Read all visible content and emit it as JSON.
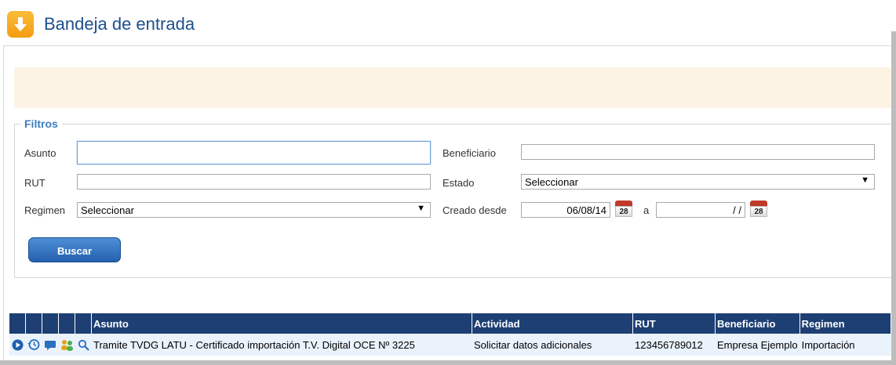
{
  "page": {
    "title": "Bandeja de entrada"
  },
  "filters": {
    "legend": "Filtros",
    "asunto_label": "Asunto",
    "asunto_value": "",
    "beneficiario_label": "Beneficiario",
    "beneficiario_value": "",
    "rut_label": "RUT",
    "rut_value": "",
    "estado_label": "Estado",
    "estado_value": "Seleccionar",
    "regimen_label": "Regimen",
    "regimen_value": "Seleccionar",
    "creado_desde_label": "Creado desde",
    "creado_desde_value": "06/08/14",
    "a_label": "a",
    "hasta_value": "/ /",
    "calendar_day": "28",
    "search_button": "Buscar"
  },
  "table": {
    "columns": [
      "Asunto",
      "Actividad",
      "RUT",
      "Beneficiario",
      "Regimen"
    ],
    "rows": [
      {
        "asunto": "Tramite TVDG LATU - Certificado importación T.V. Digital OCE Nº 3225",
        "actividad": "Solicitar datos adicionales",
        "rut": "123456789012",
        "beneficiario": "Empresa Ejemplo",
        "regimen": "Importación",
        "row_icons": [
          "play-icon",
          "history-icon",
          "comment-icon",
          "users-icon",
          "search-icon"
        ]
      }
    ]
  },
  "colors": {
    "accent": "#1d3f73",
    "title": "#1d4f8c",
    "legend": "#3b7ec2",
    "notice_bg": "#fcf3e4"
  }
}
